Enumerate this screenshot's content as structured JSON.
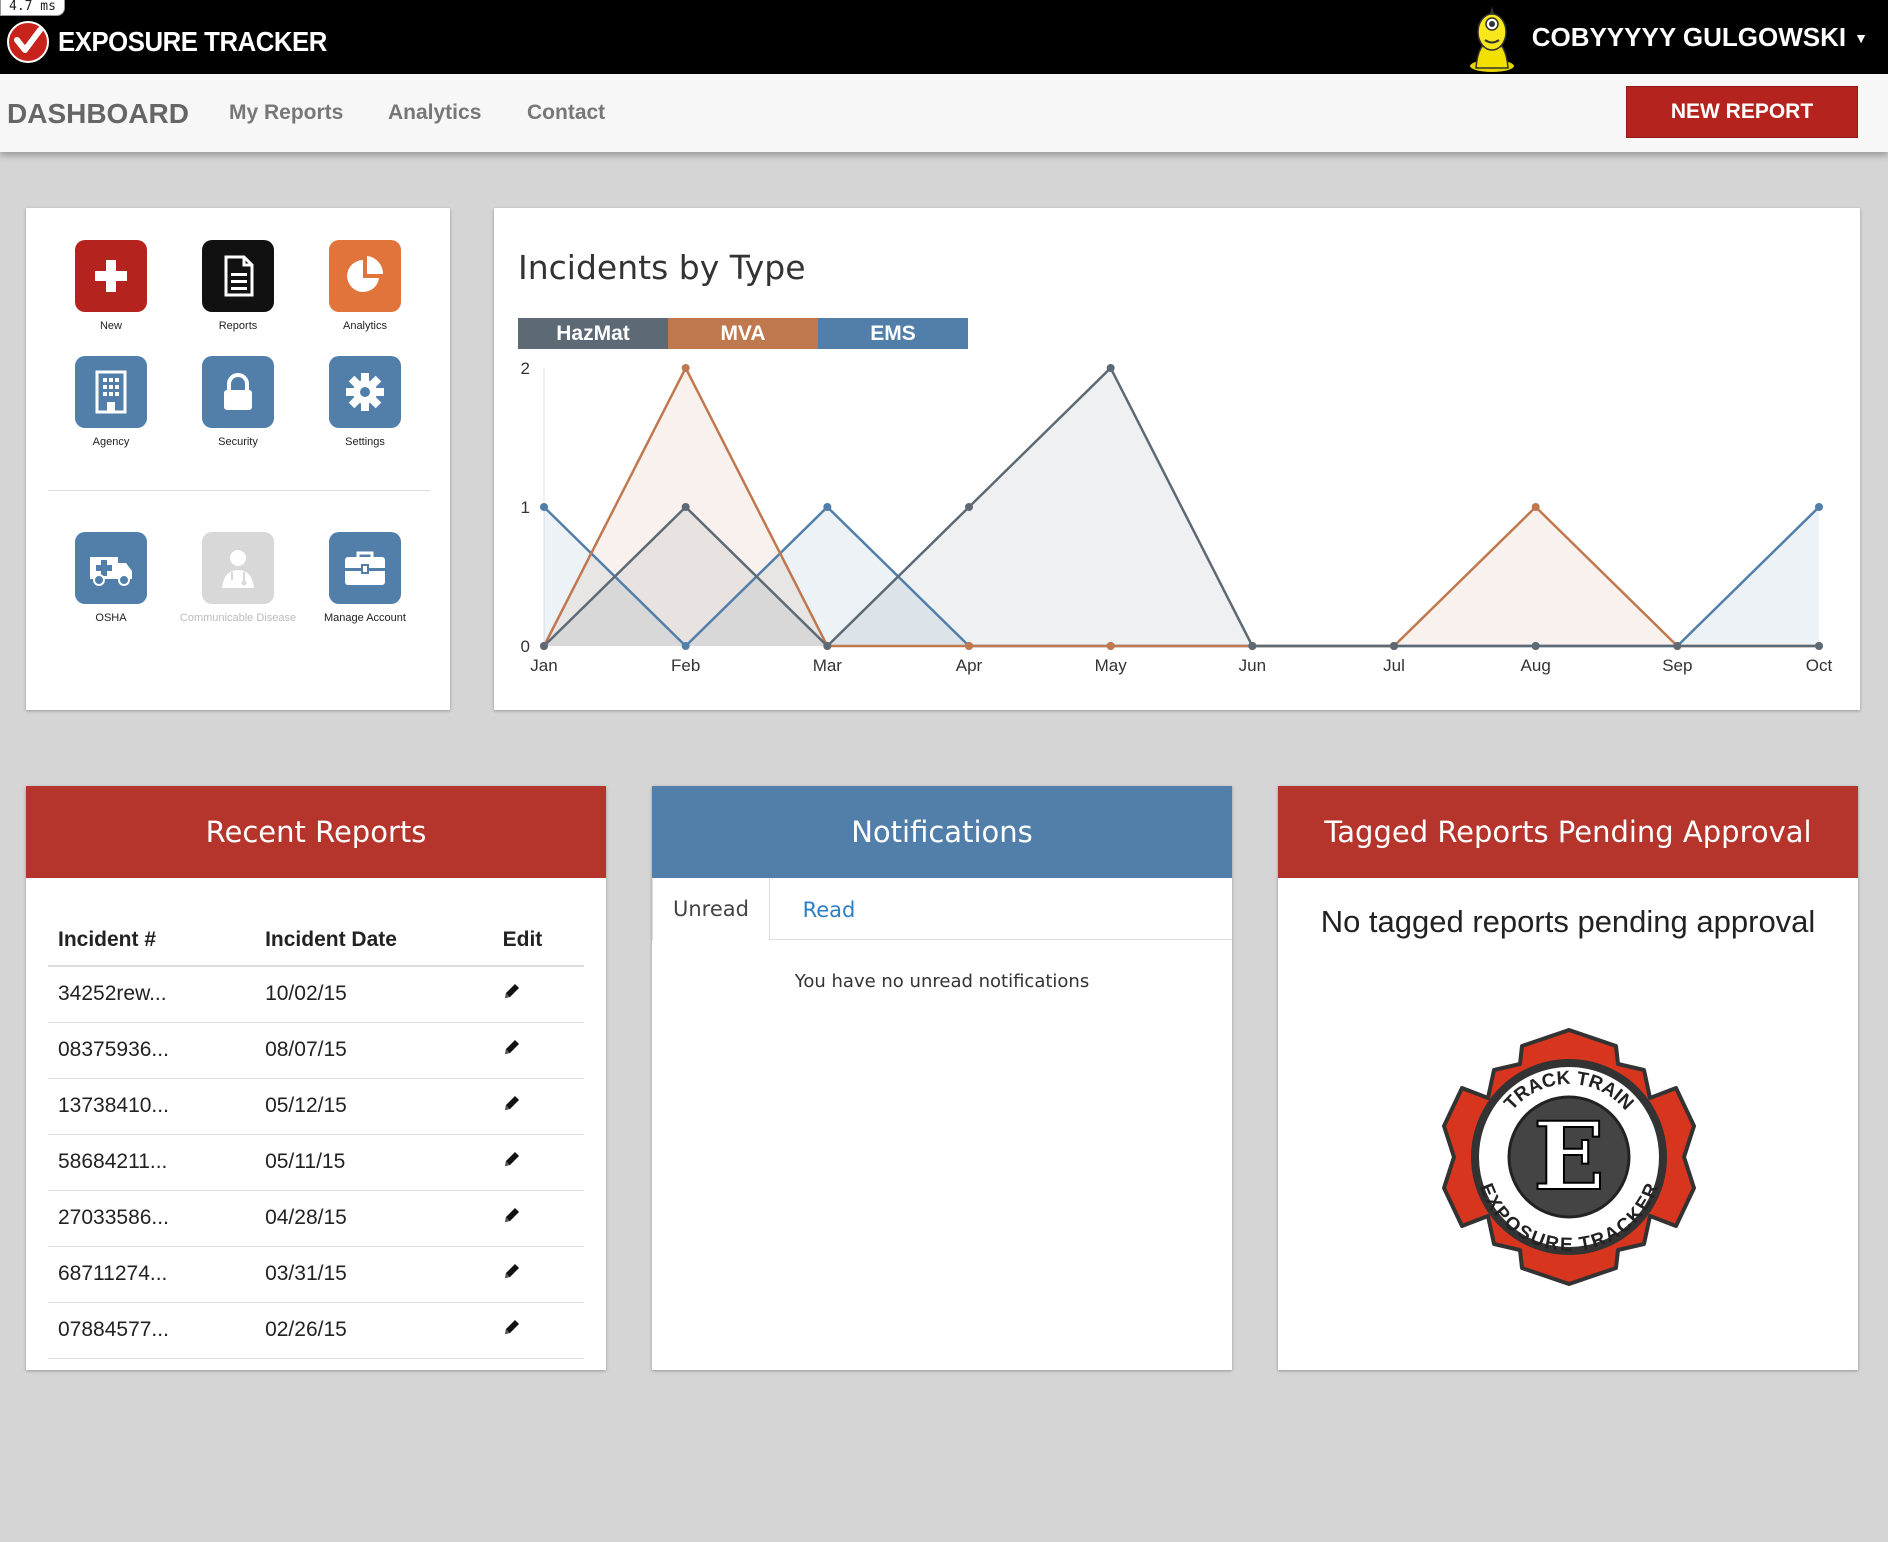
{
  "debug": {
    "timing": "4.7 ms"
  },
  "app": {
    "title": "EXPOSURE TRACKER"
  },
  "user": {
    "name": "COBYYYYY GULGOWSKI"
  },
  "nav": {
    "title": "DASHBOARD",
    "links": [
      "My Reports",
      "Analytics",
      "Contact"
    ],
    "new_report": "NEW REPORT"
  },
  "launcher": {
    "tiles": [
      {
        "label": "New",
        "icon": "plus-icon",
        "color": "#b5231f"
      },
      {
        "label": "Reports",
        "icon": "document-icon",
        "color": "#111111"
      },
      {
        "label": "Analytics",
        "icon": "pie-chart-icon",
        "color": "#e0743a"
      },
      {
        "label": "Agency",
        "icon": "building-icon",
        "color": "#517faa"
      },
      {
        "label": "Security",
        "icon": "lock-icon",
        "color": "#517faa"
      },
      {
        "label": "Settings",
        "icon": "gear-icon",
        "color": "#517faa"
      },
      {
        "label": "OSHA",
        "icon": "ambulance-icon",
        "color": "#517faa"
      },
      {
        "label": "Communicable Disease",
        "icon": "doctor-icon",
        "color": "#d8d8d8",
        "disabled": true
      },
      {
        "label": "Manage Account",
        "icon": "briefcase-icon",
        "color": "#517faa"
      }
    ]
  },
  "chart_data": {
    "type": "area",
    "title": "Incidents by Type",
    "categories": [
      "Jan",
      "Feb",
      "Mar",
      "Apr",
      "May",
      "Jun",
      "Jul",
      "Aug",
      "Sep",
      "Oct"
    ],
    "series": [
      {
        "name": "HazMat",
        "color": "#5d6a75",
        "values": [
          0,
          1,
          0,
          1,
          2,
          0,
          0,
          0,
          0,
          0
        ]
      },
      {
        "name": "MVA",
        "color": "#c0784e",
        "values": [
          0,
          2,
          0,
          0,
          0,
          0,
          0,
          1,
          0,
          0
        ]
      },
      {
        "name": "EMS",
        "color": "#517faa",
        "values": [
          1,
          0,
          1,
          0,
          0,
          0,
          0,
          0,
          0,
          1
        ]
      }
    ],
    "ylim": [
      0,
      2
    ],
    "yticks": [
      0,
      1,
      2
    ],
    "legend": "top-left"
  },
  "recent_reports": {
    "title": "Recent Reports",
    "columns": [
      "Incident #",
      "Incident Date",
      "Edit"
    ],
    "rows": [
      [
        "34252rew...",
        "10/02/15"
      ],
      [
        "08375936...",
        "08/07/15"
      ],
      [
        "13738410...",
        "05/12/15"
      ],
      [
        "58684211...",
        "05/11/15"
      ],
      [
        "27033586...",
        "04/28/15"
      ],
      [
        "68711274...",
        "03/31/15"
      ],
      [
        "07884577...",
        "02/26/15"
      ]
    ]
  },
  "notifications": {
    "title": "Notifications",
    "tabs": [
      "Unread",
      "Read"
    ],
    "empty": "You have no unread notifications"
  },
  "tagged": {
    "title": "Tagged Reports Pending Approval",
    "empty": "No tagged reports pending approval",
    "badge_top": "TRACK TRAIN",
    "badge_letter": "E",
    "badge_bottom": "EXPOSURE TRACKER"
  }
}
